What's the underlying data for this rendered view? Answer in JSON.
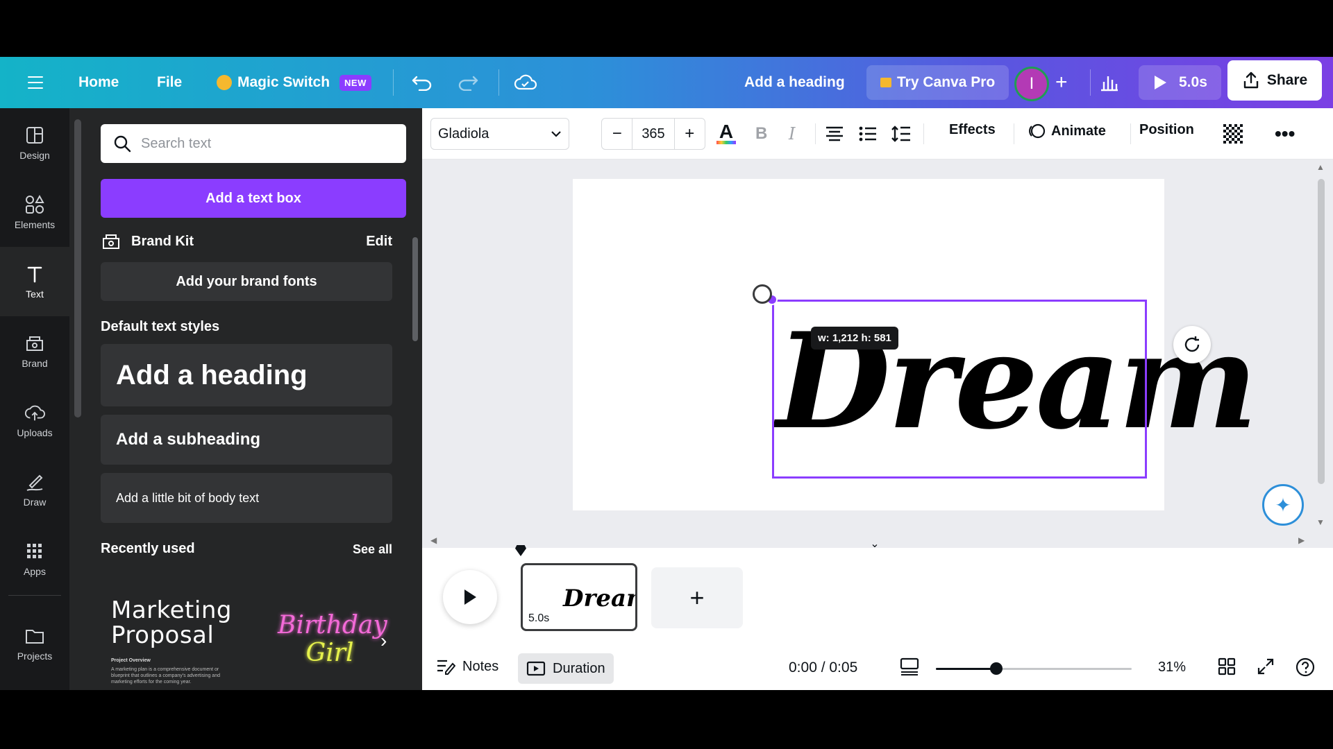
{
  "header": {
    "home": "Home",
    "file": "File",
    "magic_switch": "Magic Switch",
    "magic_badge": "NEW",
    "design_title": "Add a heading",
    "try_pro": "Try Canva Pro",
    "avatar_initial": "I",
    "play_duration": "5.0s",
    "share": "Share"
  },
  "rail": {
    "items": [
      {
        "label": "Design",
        "icon": "layout-icon"
      },
      {
        "label": "Elements",
        "icon": "shapes-icon"
      },
      {
        "label": "Text",
        "icon": "text-icon"
      },
      {
        "label": "Brand",
        "icon": "brand-icon"
      },
      {
        "label": "Uploads",
        "icon": "cloud-upload-icon"
      },
      {
        "label": "Draw",
        "icon": "pen-icon"
      },
      {
        "label": "Apps",
        "icon": "grid-icon"
      },
      {
        "label": "Projects",
        "icon": "folder-icon"
      }
    ],
    "active": "Text"
  },
  "panel": {
    "search_placeholder": "Search text",
    "add_textbox": "Add a text box",
    "brand_kit": "Brand Kit",
    "brand_edit": "Edit",
    "add_brand_fonts": "Add your brand fonts",
    "default_styles_title": "Default text styles",
    "heading": "Add a heading",
    "subheading": "Add a subheading",
    "body": "Add a little bit of body text",
    "recently_used": "Recently used",
    "see_all": "See all",
    "recent": {
      "marketing_line1": "Marketing",
      "marketing_line2": "Proposal",
      "marketing_sub_title": "Project Overview",
      "marketing_sub_body": "A marketing plan is a comprehensive document or blueprint that outlines a company's advertising and marketing efforts for the coming year.",
      "birthday_line1": "Birthday",
      "birthday_line2": "Girl"
    }
  },
  "toolbar": {
    "font": "Gladiola",
    "font_size": "365",
    "effects": "Effects",
    "animate": "Animate",
    "position": "Position"
  },
  "canvas": {
    "text": "Dream",
    "dimensions": "w: 1,212 h: 581"
  },
  "timeline": {
    "thumb_text": "Dream",
    "thumb_duration": "5.0s"
  },
  "bottom": {
    "notes": "Notes",
    "duration": "Duration",
    "time": "0:00 / 0:05",
    "zoom": "31%",
    "zoom_fraction": 0.31
  },
  "colors": {
    "accent": "#8b3dff",
    "header_start": "#14b3c8",
    "header_end": "#7b3fe4",
    "panel_bg": "#252627",
    "rail_bg": "#18191b"
  }
}
